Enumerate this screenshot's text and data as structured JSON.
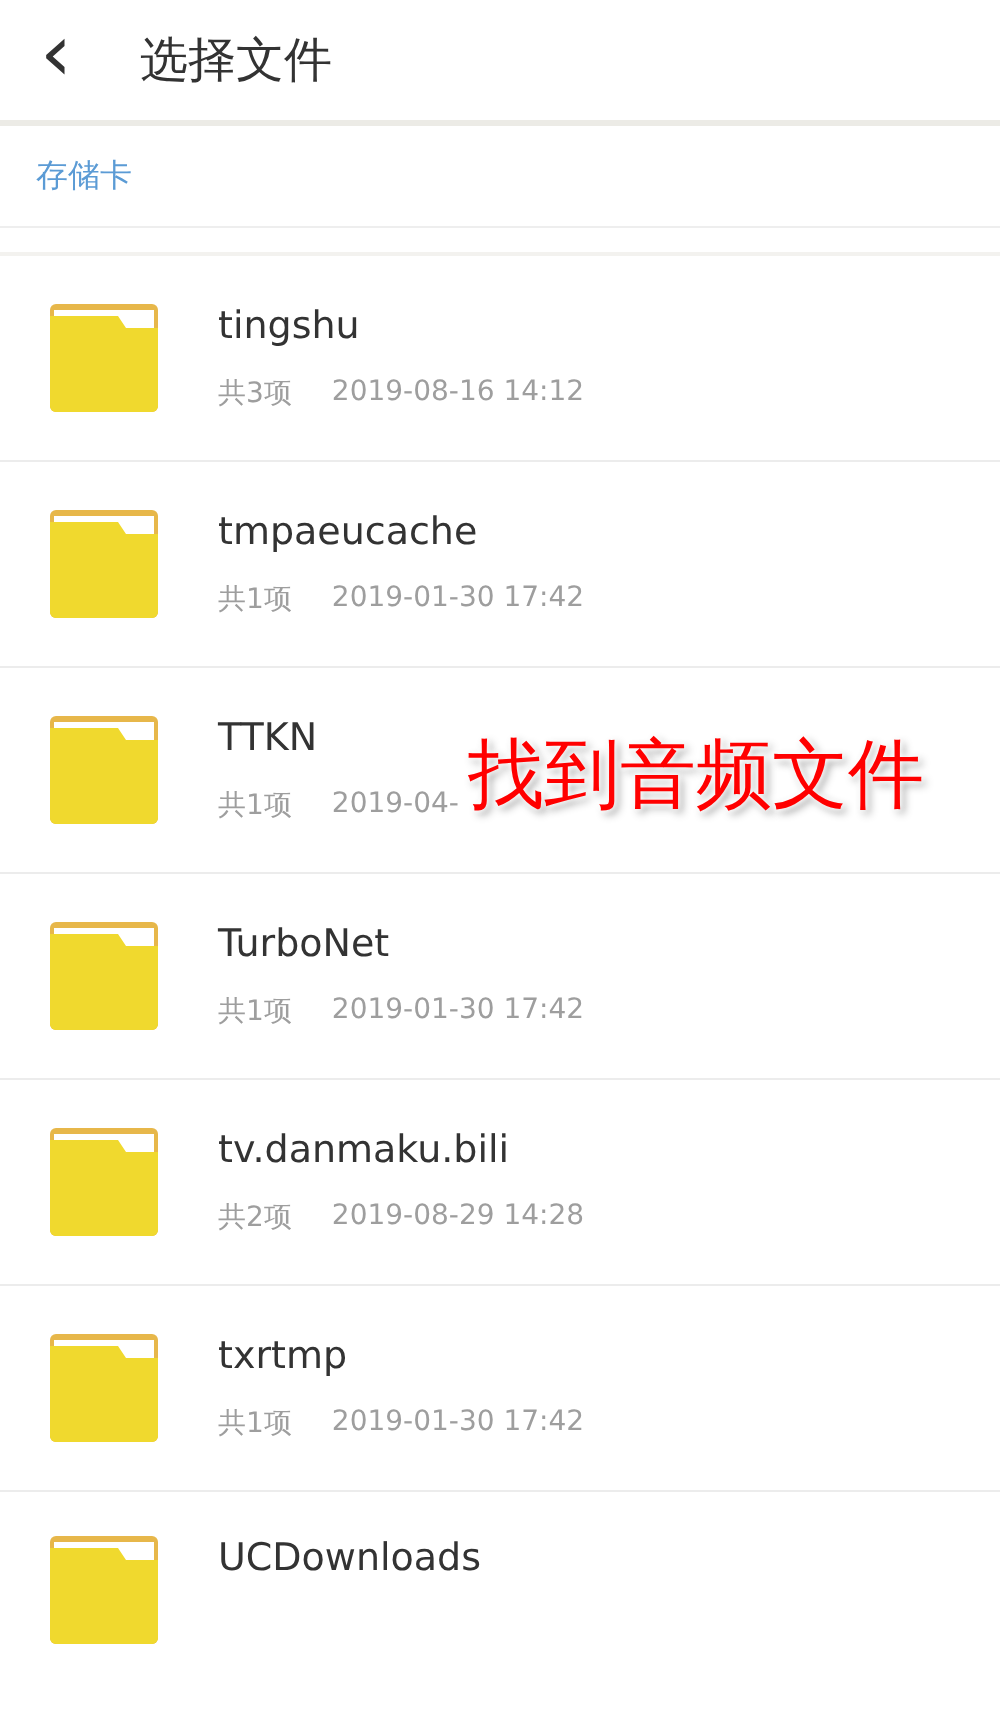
{
  "header": {
    "back": "‹",
    "title": "选择文件"
  },
  "breadcrumb": "存储卡",
  "folders": [
    {
      "name": "tingshu",
      "count": "共3项",
      "date": "2019-08-16 14:12"
    },
    {
      "name": "tmpaeucache",
      "count": "共1项",
      "date": "2019-01-30 17:42"
    },
    {
      "name": "TTKN",
      "count": "共1项",
      "date": "2019-04-"
    },
    {
      "name": "TurboNet",
      "count": "共1项",
      "date": "2019-01-30 17:42"
    },
    {
      "name": "tv.danmaku.bili",
      "count": "共2项",
      "date": "2019-08-29 14:28"
    },
    {
      "name": "txrtmp",
      "count": "共1项",
      "date": "2019-01-30 17:42"
    },
    {
      "name": "UCDownloads"
    }
  ],
  "annotation": "找到音频文件"
}
